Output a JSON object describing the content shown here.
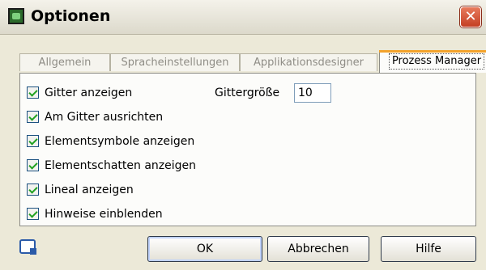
{
  "window": {
    "title": "Optionen",
    "close_symbol": "✕",
    "app_icon": "app-icon",
    "close_color": "#d44c2c"
  },
  "tabs": [
    {
      "label": "Allgemein",
      "selected": false
    },
    {
      "label": "Spracheinstellungen",
      "selected": false
    },
    {
      "label": "Applikationsdesigner",
      "selected": false
    },
    {
      "label": "Prozess Manager",
      "selected": true
    }
  ],
  "options": [
    {
      "label": "Gitter anzeigen",
      "checked": true
    },
    {
      "label": "Am Gitter ausrichten",
      "checked": true
    },
    {
      "label": "Elementsymbole anzeigen",
      "checked": true
    },
    {
      "label": "Elementschatten anzeigen",
      "checked": true
    },
    {
      "label": "Lineal anzeigen",
      "checked": true
    },
    {
      "label": "Hinweise einblenden",
      "checked": true
    }
  ],
  "grid_size": {
    "label": "Gittergröße",
    "value": "10"
  },
  "buttons": {
    "ok": "OK",
    "cancel": "Abbrechen",
    "help": "Hilfe"
  },
  "footer_icon": "help-context-icon"
}
